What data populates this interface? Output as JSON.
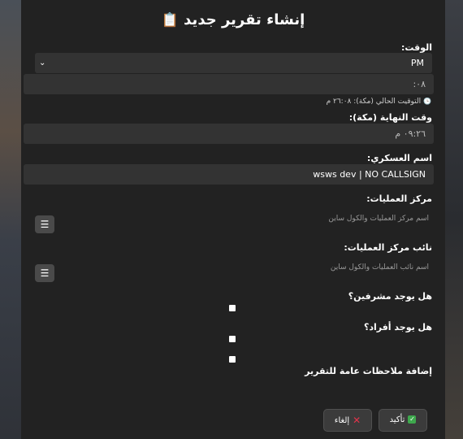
{
  "title": {
    "text": "إنشاء تقرير جديد",
    "icon": "clipboard-icon",
    "emoji": "📋"
  },
  "time": {
    "label": "الوقت:",
    "ampm_value": "PM",
    "minutes_value": ":٠٨",
    "hint_icon": "clock-icon",
    "hint_glyph": "🕒",
    "hint": "التوقيت الحالي (مكة): ٢٦:٠٨ م"
  },
  "end_time": {
    "label": "وقت النهاية (مكة):",
    "value": "٠٩:٢٦ م"
  },
  "soldier": {
    "label": "اسم العسكري:",
    "value": "wsws dev | NO CALLSIGN"
  },
  "ops_center": {
    "label": "مركز العمليات:",
    "placeholder": "اسم مركز العمليات والكول ساين",
    "menu_glyph": "☰"
  },
  "deputy_ops": {
    "label": "نائب مركز العمليات:",
    "placeholder": "اسم نائب العمليات والكول ساين",
    "menu_glyph": "☰"
  },
  "supervisors": {
    "label": "هل يوجد مشرفين؟"
  },
  "members": {
    "label": "هل يوجد أفراد؟"
  },
  "notes": {
    "label": "إضافة ملاحظات عامة للتقرير"
  },
  "buttons": {
    "confirm_label": "تأكيد",
    "confirm_glyph": "✓",
    "cancel_label": "إلغاء",
    "cancel_glyph": "✕"
  },
  "colors": {
    "panel": "#222222",
    "field": "#333333",
    "confirm": "#3ea84d",
    "cancel": "#e0344b"
  }
}
